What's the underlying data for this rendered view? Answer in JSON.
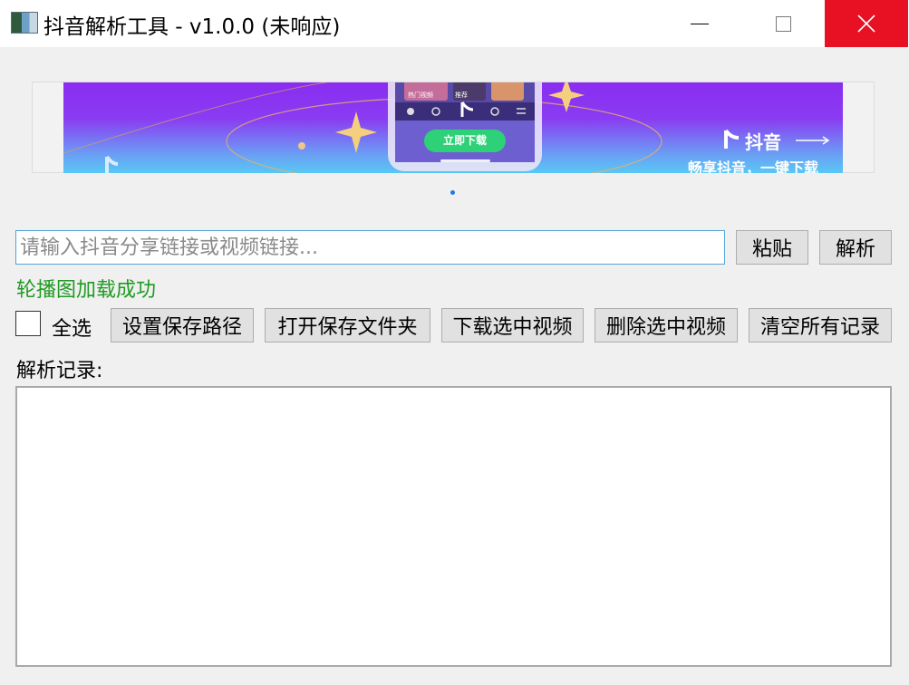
{
  "window": {
    "title": "抖音解析工具 - v1.0.0 (未响应)",
    "icons": {
      "app": "app-icon",
      "minimize": "minimize-icon",
      "maximize": "maximize-icon",
      "close": "close-icon"
    },
    "colors": {
      "close_bg": "#e81123"
    }
  },
  "banner": {
    "button_label": "立即下载",
    "brand": "抖音",
    "slogan": "畅享抖音，一键下载",
    "phone_tabs": [
      "热门视频",
      "推荐"
    ],
    "pager": {
      "count": 1,
      "active": 1
    },
    "colors": {
      "top": "#8a2cf0",
      "bottom": "#58c8f4",
      "button": "#2ed177"
    }
  },
  "search": {
    "placeholder": "请输入抖音分享链接或视频链接...",
    "value": "",
    "paste_label": "粘贴",
    "parse_label": "解析"
  },
  "status": {
    "text": "轮播图加载成功",
    "color": "#1f9a22"
  },
  "toolbar": {
    "select_all_label": "全选",
    "select_all_checked": false,
    "set_path_label": "设置保存路径",
    "open_folder_label": "打开保存文件夹",
    "download_label": "下载选中视频",
    "delete_label": "删除选中视频",
    "clear_label": "清空所有记录"
  },
  "records": {
    "label": "解析记录:",
    "items": []
  }
}
